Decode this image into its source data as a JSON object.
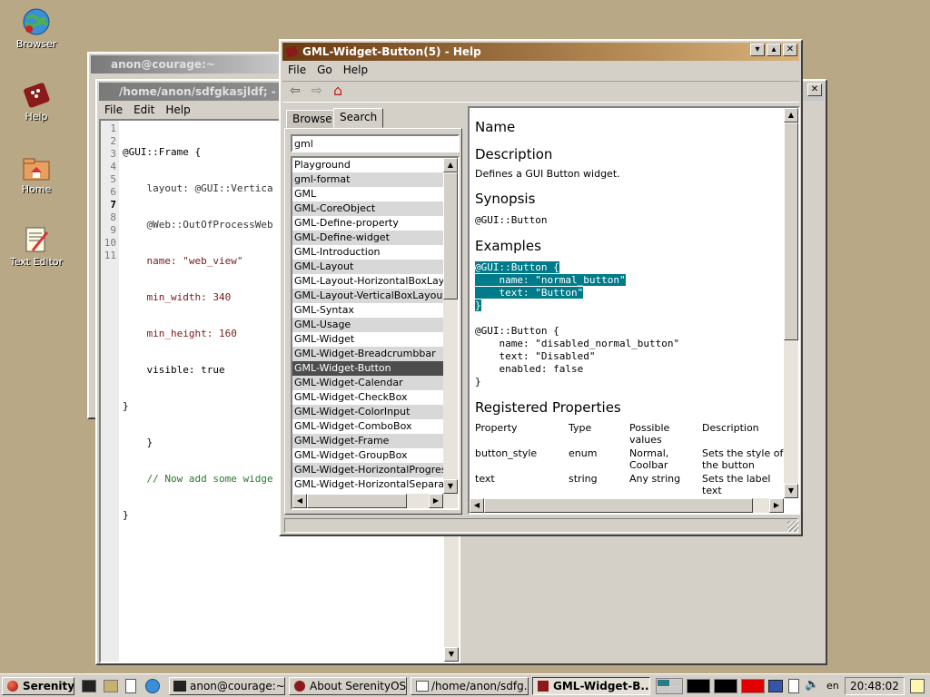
{
  "desktop": {
    "icons": [
      {
        "label": "Browser",
        "icon": "globe-icon"
      },
      {
        "label": "Help",
        "icon": "help-book-icon"
      },
      {
        "label": "Home",
        "icon": "home-folder-icon"
      },
      {
        "label": "Text Editor",
        "icon": "text-editor-icon"
      }
    ]
  },
  "terminal_window": {
    "title": "anon@courage:~"
  },
  "editor_window": {
    "title": "/home/anon/sdfgkasjldf; - GML",
    "menu": [
      "File",
      "Edit",
      "Help"
    ],
    "line_numbers": [
      "1",
      "2",
      "3",
      "4",
      "5",
      "6",
      "7",
      "8",
      "9",
      "10",
      "11"
    ],
    "lines": [
      "@GUI::Frame {",
      "    layout: @GUI::Vertica",
      "    @Web::OutOfProcessWeb",
      "    name: \"web_view\"",
      "    min_width: 340",
      "    min_height: 160",
      "    visible: true",
      "}",
      "    }",
      "    // Now add some widge",
      "}"
    ]
  },
  "help_window": {
    "title": "GML-Widget-Button(5) - Help",
    "menu": [
      "File",
      "Go",
      "Help"
    ],
    "toolbar": {
      "back": "⇦",
      "forward": "⇨",
      "home": "⌂"
    },
    "tabs": [
      "Browse",
      "Search"
    ],
    "search_value": "gml",
    "results": [
      "Playground",
      "gml-format",
      "GML",
      "GML-CoreObject",
      "GML-Define-property",
      "GML-Define-widget",
      "GML-Introduction",
      "GML-Layout",
      "GML-Layout-HorizontalBoxLayout",
      "GML-Layout-VerticalBoxLayout",
      "GML-Syntax",
      "GML-Usage",
      "GML-Widget",
      "GML-Widget-Breadcrumbbar",
      "GML-Widget-Button",
      "GML-Widget-Calendar",
      "GML-Widget-CheckBox",
      "GML-Widget-ColorInput",
      "GML-Widget-ComboBox",
      "GML-Widget-Frame",
      "GML-Widget-GroupBox",
      "GML-Widget-HorizontalProgressbar",
      "GML-Widget-HorizontalSeparator"
    ],
    "selected_index": 14,
    "doc": {
      "h_name": "Name",
      "h_description": "Description",
      "description": "Defines a GUI Button widget.",
      "h_synopsis": "Synopsis",
      "synopsis": "@GUI::Button",
      "h_examples": "Examples",
      "example1": [
        "@GUI::Button {",
        "    name: \"normal_button\"",
        "    text: \"Button\"",
        "}"
      ],
      "example2": [
        "@GUI::Button {",
        "    name: \"disabled_normal_button\"",
        "    text: \"Disabled\"",
        "    enabled: false",
        "}"
      ],
      "h_registered": "Registered Properties",
      "props_header": [
        "Property",
        "Type",
        "Possible values",
        "Description"
      ],
      "props_rows": [
        [
          "button_style",
          "enum",
          "Normal, Coolbar",
          "Sets the style of the button"
        ],
        [
          "text",
          "string",
          "Any string",
          "Sets the label text"
        ]
      ]
    }
  },
  "taskbar": {
    "start": "Serenity",
    "tasks": [
      "anon@courage:~",
      "About SerenityOS",
      "/home/anon/sdfg...",
      "GML-Widget-B..."
    ],
    "keyboard_layout": "en",
    "clock": "20:48:02"
  },
  "colors": {
    "desktop": "#b8a886",
    "selection": "#007b8a",
    "active_title": "#6a3a10"
  }
}
